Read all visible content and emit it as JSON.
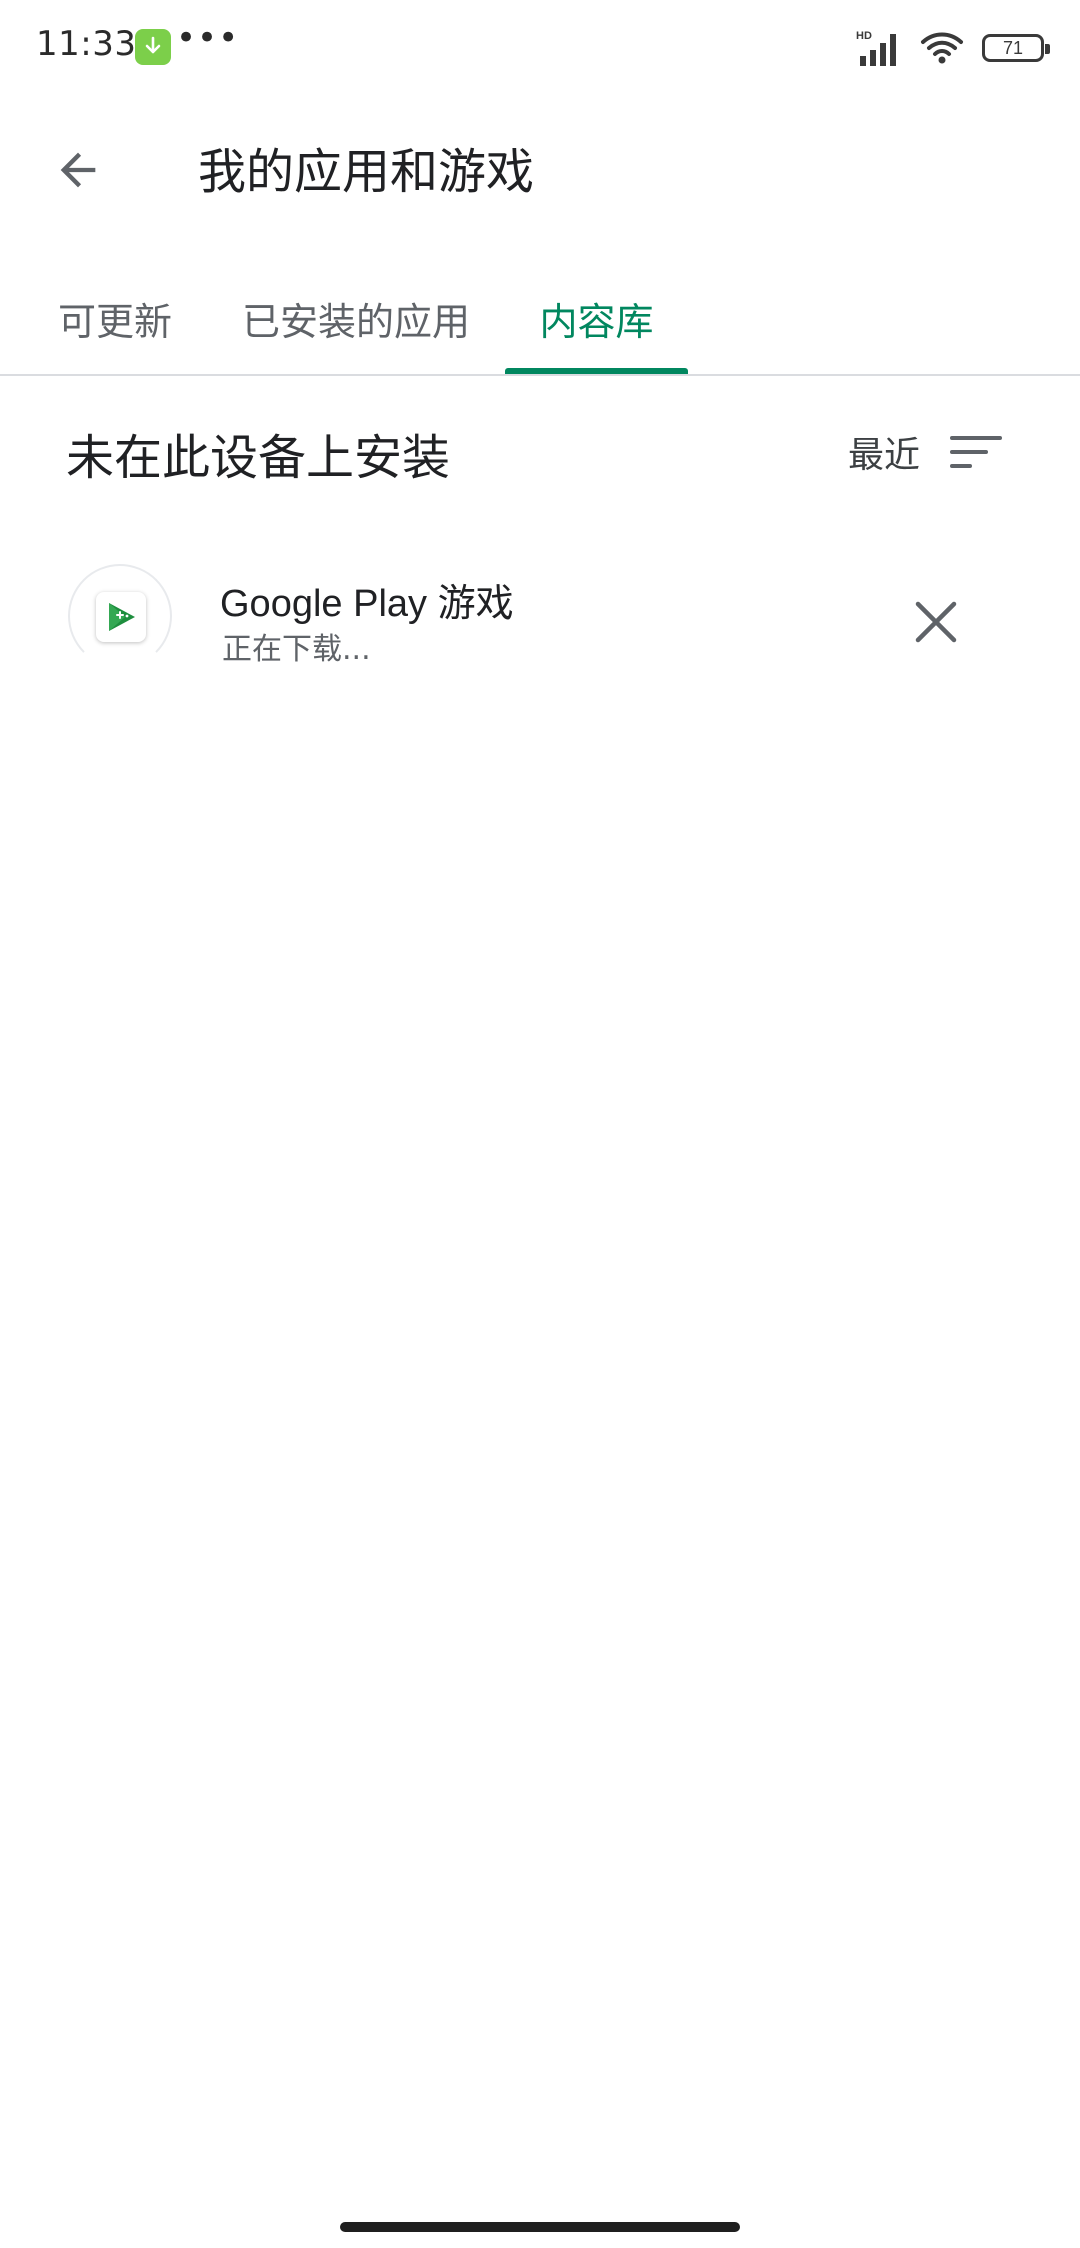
{
  "status_bar": {
    "time": "11:33",
    "notifications": [
      "download-icon",
      "more-dots-icon"
    ],
    "dots": "•••",
    "network_label": "HD",
    "battery": "71",
    "icons": [
      "signal-icon",
      "wifi-icon",
      "battery-icon"
    ]
  },
  "app_bar": {
    "back_icon": "back-arrow-icon",
    "title": "我的应用和游戏"
  },
  "tabs": [
    {
      "label": "可更新",
      "active": false
    },
    {
      "label": "已安装的应用",
      "active": false
    },
    {
      "label": "内容库",
      "active": true
    }
  ],
  "accent_color": "#01875f",
  "section": {
    "title": "未在此设备上安装",
    "sort_label": "最近",
    "sort_icon": "sort-icon"
  },
  "apps": [
    {
      "name": "Google Play 游戏",
      "status": "正在下载...",
      "icon": "google-play-games-icon",
      "action_icon": "close-icon"
    }
  ]
}
